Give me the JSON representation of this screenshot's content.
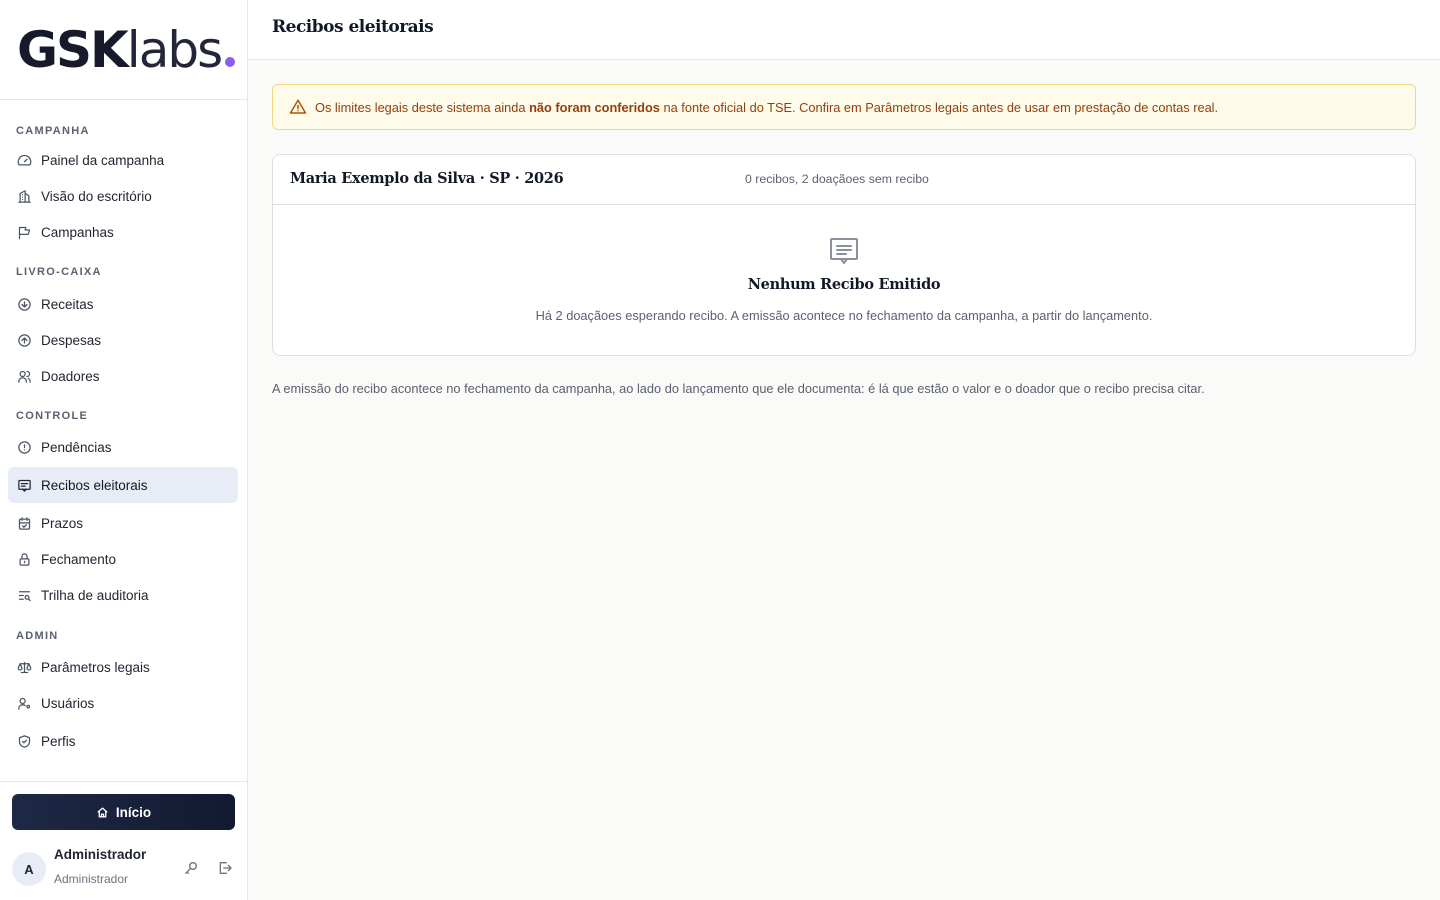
{
  "brand": {
    "bold": "GSK",
    "light": "labs",
    "dot_color": "#8b5cf6"
  },
  "sidebar": {
    "sections": [
      {
        "title": "CAMPANHA",
        "items": [
          {
            "label": "Painel da campanha",
            "icon": "gauge-icon"
          },
          {
            "label": "Visão do escritório",
            "icon": "building-icon"
          },
          {
            "label": "Campanhas",
            "icon": "flag-icon"
          }
        ]
      },
      {
        "title": "LIVRO-CAIXA",
        "items": [
          {
            "label": "Receitas",
            "icon": "arrow-down-circle-icon"
          },
          {
            "label": "Despesas",
            "icon": "arrow-up-circle-icon"
          },
          {
            "label": "Doadores",
            "icon": "users-icon"
          }
        ]
      },
      {
        "title": "CONTROLE",
        "items": [
          {
            "label": "Pendências",
            "icon": "alert-circle-icon"
          },
          {
            "label": "Recibos eleitorais",
            "icon": "receipt-icon",
            "active": true
          },
          {
            "label": "Prazos",
            "icon": "calendar-check-icon"
          },
          {
            "label": "Fechamento",
            "icon": "lock-icon"
          },
          {
            "label": "Trilha de auditoria",
            "icon": "list-search-icon"
          }
        ]
      },
      {
        "title": "ADMIN",
        "items": [
          {
            "label": "Parâmetros legais",
            "icon": "scale-icon"
          },
          {
            "label": "Usuários",
            "icon": "user-gear-icon"
          },
          {
            "label": "Perfis",
            "icon": "shield-check-icon"
          }
        ]
      }
    ],
    "home_label": "Início",
    "user": {
      "initial": "A",
      "name": "Administrador",
      "role": "Administrador"
    }
  },
  "header": {
    "title": "Recibos eleitorais"
  },
  "alert": {
    "text_before": "Os limites legais deste sistema ainda ",
    "text_strong": "não foram conferidos",
    "text_after": " na fonte oficial do TSE. Confira em Parâmetros legais antes de usar em prestação de contas real."
  },
  "card": {
    "title": "Maria Exemplo da Silva · SP · 2026",
    "meta": "0 recibos, 2 doaçãoes sem recibo",
    "empty_title": "Nenhum Recibo Emitido",
    "empty_desc": "Há 2 doaçãoes esperando recibo. A emissão acontece no fechamento da campanha, a partir do lançamento."
  },
  "footnote": "A emissão do recibo acontece no fechamento da campanha, ao lado do lançamento que ele documenta: é lá que estão o valor e o doador que o recibo precisa citar.",
  "colors": {
    "accent": "#8b5cf6",
    "active_bg": "#e8ecf6",
    "alert_bg": "#fefbea",
    "alert_text": "#92400e",
    "home_btn": "#1a2440"
  }
}
